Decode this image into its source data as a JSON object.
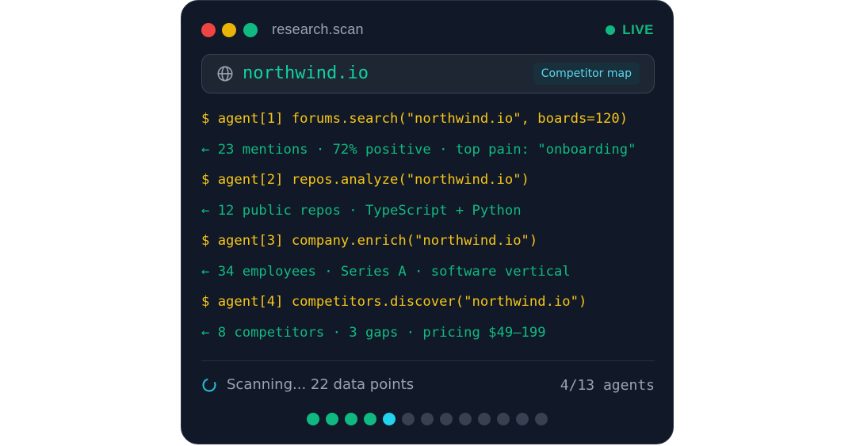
{
  "window": {
    "title": "research.scan",
    "live_label": "LIVE"
  },
  "urlbar": {
    "icon": "globe-icon",
    "url": "northwind.io",
    "tag": "Competitor map"
  },
  "log": [
    {
      "kind": "cmd",
      "text": "$ agent[1] forums.search(\"northwind.io\", boards=120)"
    },
    {
      "kind": "res",
      "text": "← 23 mentions · 72% positive · top pain: \"onboarding\""
    },
    {
      "kind": "cmd",
      "text": "$ agent[2] repos.analyze(\"northwind.io\")"
    },
    {
      "kind": "res",
      "text": "← 12 public repos · TypeScript + Python"
    },
    {
      "kind": "cmd",
      "text": "$ agent[3] company.enrich(\"northwind.io\")"
    },
    {
      "kind": "res",
      "text": "← 34 employees · Series A · software vertical"
    },
    {
      "kind": "cmd",
      "text": "$ agent[4] competitors.discover(\"northwind.io\")"
    },
    {
      "kind": "res",
      "text": "← 8 competitors · 3 gaps · pricing $49–199"
    }
  ],
  "status": {
    "scanning_text": "Scanning... 22 data points",
    "agents_text": "4/13 agents"
  },
  "progress": {
    "total": 13,
    "completed": 4,
    "active_index": 4
  },
  "colors": {
    "background": "#111827",
    "accent_green": "#10b981",
    "command_yellow": "#f5c518",
    "active_cyan": "#22d3ee",
    "traffic_red": "#ef4444",
    "traffic_yellow": "#eab308"
  }
}
